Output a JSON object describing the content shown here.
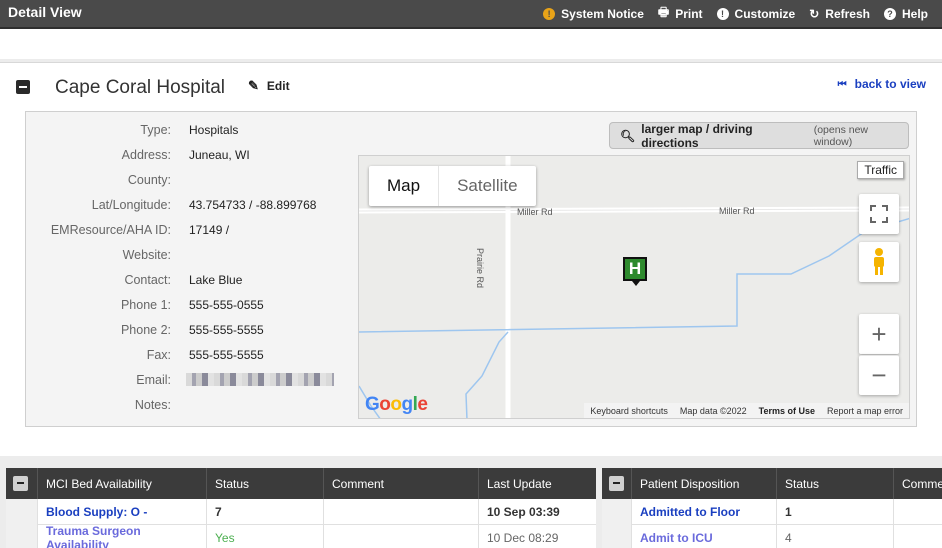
{
  "app": {
    "title": "Detail View"
  },
  "toolbar": {
    "system_notice": "System Notice",
    "print": "Print",
    "customize": "Customize",
    "refresh": "Refresh",
    "help": "Help"
  },
  "facility": {
    "name": "Cape Coral Hospital",
    "edit_label": "Edit",
    "back_label": "back to view",
    "fields": [
      {
        "label": "Type:",
        "value": "Hospitals"
      },
      {
        "label": "Address:",
        "value": "Juneau, WI"
      },
      {
        "label": "County:",
        "value": ""
      },
      {
        "label": "Lat/Longitude:",
        "value": "43.754733 / -88.899768"
      },
      {
        "label": "EMResource/AHA ID:",
        "value": "17149 /"
      },
      {
        "label": "Website:",
        "value": ""
      },
      {
        "label": "Contact:",
        "value": "Lake Blue"
      },
      {
        "label": "Phone 1:",
        "value": "555-555-0555"
      },
      {
        "label": "Phone 2:",
        "value": "555-555-5555"
      },
      {
        "label": "Fax:",
        "value": "555-555-5555"
      },
      {
        "label": "Email:",
        "value": ""
      },
      {
        "label": "Notes:",
        "value": ""
      }
    ]
  },
  "map": {
    "larger_label": "larger map / driving directions",
    "larger_sub": "(opens new window)",
    "type_map": "Map",
    "type_satellite": "Satellite",
    "traffic": "Traffic",
    "roads": {
      "miller_1": "Miller Rd",
      "miller_2": "Miller Rd",
      "prairie": "Prairie Rd"
    },
    "marker": "H",
    "footer": {
      "shortcuts": "Keyboard shortcuts",
      "data": "Map data ©2022",
      "terms": "Terms of Use",
      "report": "Report a map error"
    },
    "logo": [
      "G",
      "o",
      "o",
      "g",
      "l",
      "e"
    ]
  },
  "mci_table": {
    "headers": [
      "MCI Bed Availability",
      "Status",
      "Comment",
      "Last Update"
    ],
    "rows": [
      {
        "name": "Blood Supply: O -",
        "status": "7",
        "comment": "",
        "updated": "10 Sep 03:39"
      },
      {
        "name": "Trauma Surgeon Availability",
        "status": "Yes",
        "comment": "",
        "updated": "10 Dec 08:29"
      }
    ]
  },
  "disposition_table": {
    "headers": [
      "Patient Disposition",
      "Status",
      "Comme"
    ],
    "rows": [
      {
        "name": "Admitted to Floor",
        "status": "1"
      },
      {
        "name": "Admit to ICU",
        "status": "4"
      }
    ]
  }
}
